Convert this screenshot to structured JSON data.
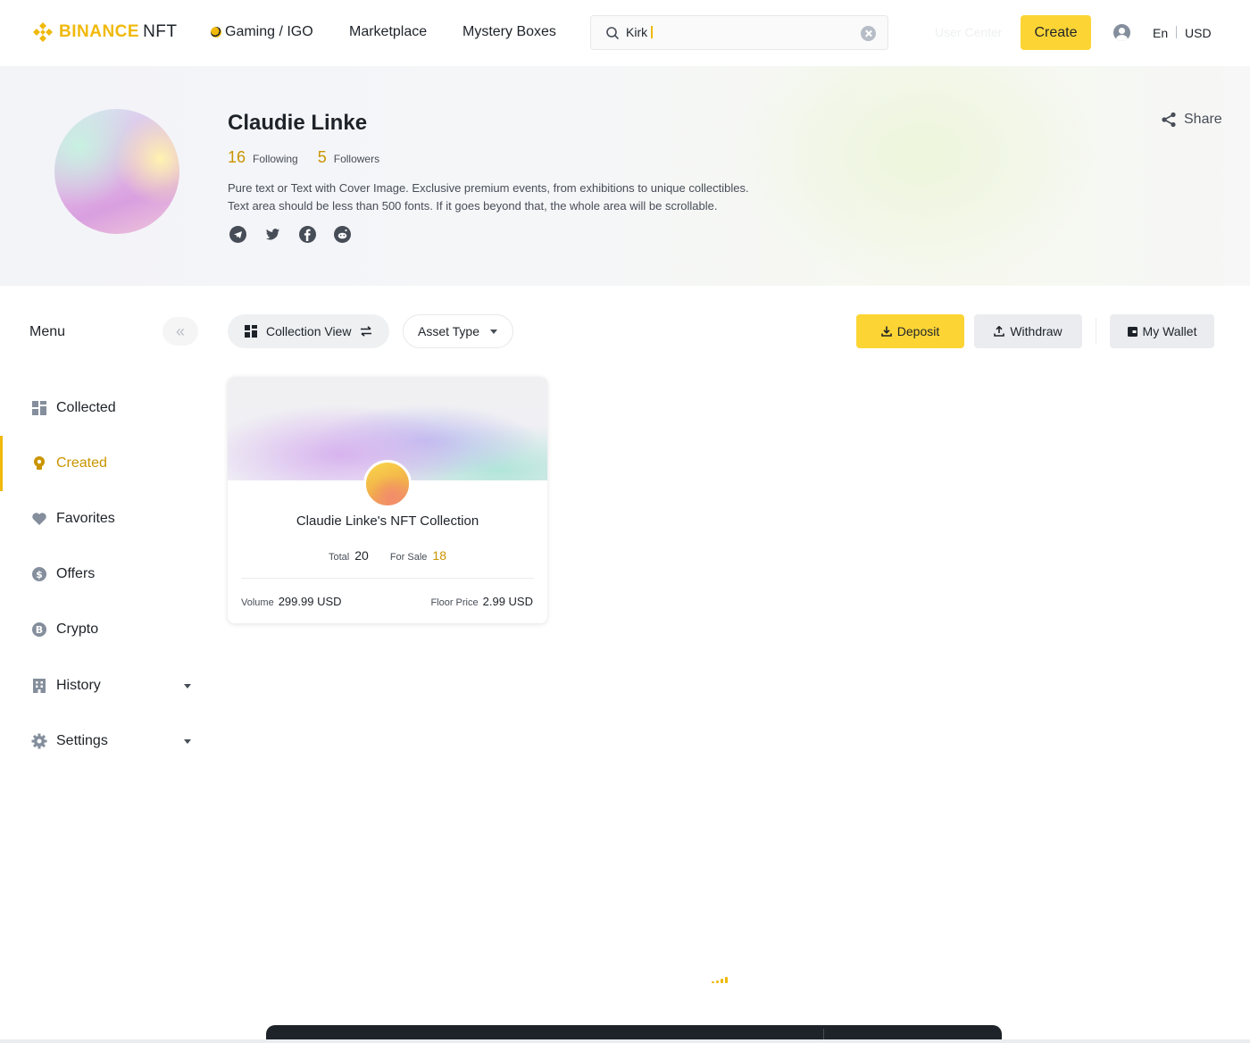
{
  "header": {
    "brand_main": "BINANCE",
    "brand_sub": "NFT",
    "nav": [
      "Gaming / IGO",
      "Marketplace",
      "Mystery Boxes"
    ],
    "search_value": "Kirk",
    "user_center": "User Center",
    "create_label": "Create",
    "language": "En",
    "currency": "USD"
  },
  "profile": {
    "name": "Claudie Linke",
    "following_count": "16",
    "following_label": "Following",
    "followers_count": "5",
    "followers_label": "Followers",
    "bio_line1": "Pure text or Text with Cover Image. Exclusive premium events, from exhibitions to unique collectibles.",
    "bio_line2": "Text area should be less than 500 fonts. If it goes beyond that, the whole area will be scrollable.",
    "socials": [
      "telegram-icon",
      "twitter-icon",
      "facebook-icon",
      "reddit-icon"
    ],
    "share_label": "Share"
  },
  "sidebar": {
    "title": "Menu",
    "items": [
      {
        "label": "Collected",
        "icon": "grid-icon"
      },
      {
        "label": "Created",
        "icon": "bulb-icon",
        "active": true
      },
      {
        "label": "Favorites",
        "icon": "heart-icon"
      },
      {
        "label": "Offers",
        "icon": "dollar-icon"
      },
      {
        "label": "Crypto",
        "icon": "bitcoin-icon"
      },
      {
        "label": "History",
        "icon": "history-icon",
        "expandable": true
      },
      {
        "label": "Settings",
        "icon": "gear-icon",
        "expandable": true
      }
    ]
  },
  "toolbar": {
    "view_label": "Collection View",
    "asset_type_label": "Asset Type",
    "deposit_label": "Deposit",
    "withdraw_label": "Withdraw",
    "wallet_label": "My Wallet"
  },
  "collection_card": {
    "title": "Claudie Linke's NFT Collection",
    "total_label": "Total",
    "total_value": "20",
    "for_sale_label": "For Sale",
    "for_sale_value": "18",
    "volume_label": "Volume",
    "volume_value": "299.99 USD",
    "floor_label": "Floor Price",
    "floor_value": "2.99 USD"
  },
  "colors": {
    "accent": "#f0b90b",
    "button_yellow": "#fcd535",
    "gold_text": "#c99400",
    "text_primary": "#1e2329",
    "text_secondary": "#474d57"
  }
}
